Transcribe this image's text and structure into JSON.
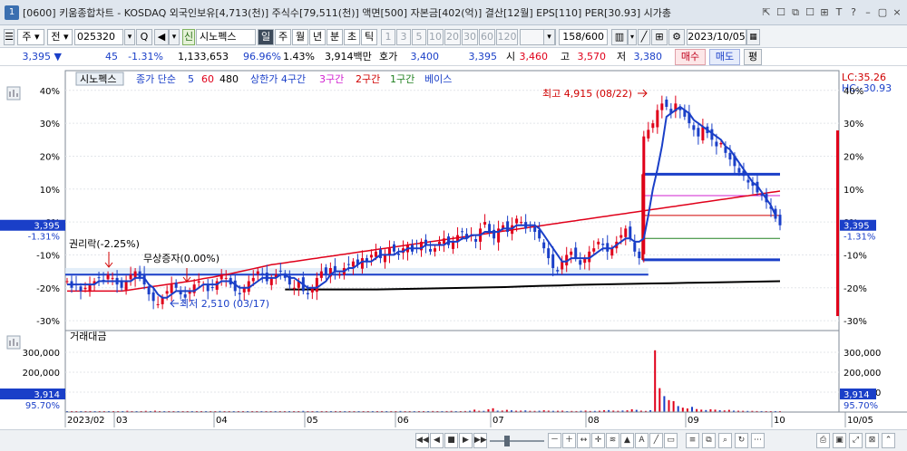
{
  "window": {
    "number": "1",
    "title": "[0600] 키움종합차트 - KOSDAQ 외국인보유[4,713(천)] 주식수[79,511(천)] 액면[500] 자본금[402(억)] 결산[12월] EPS[110] PER[30.93] 시가총",
    "controls": [
      "⇱",
      "☐",
      "⧉",
      "☐",
      "⊞",
      "T",
      "?",
      "–",
      "▢",
      "×"
    ]
  },
  "toolbar": {
    "stock_type": "주",
    "prefix": "전",
    "code": "025320",
    "search_label": "Q",
    "stock_badge": "신",
    "stock_name": "시노펙스",
    "periods": [
      "일",
      "주",
      "월",
      "년",
      "분",
      "초",
      "틱"
    ],
    "active_period": "일",
    "intervals": [
      "1",
      "3",
      "5",
      "10",
      "20",
      "30",
      "60",
      "120"
    ],
    "count": "158/600",
    "date": "2023/10/05"
  },
  "quote": {
    "price": "3,395",
    "change_arrow": "▼",
    "change": "45",
    "change_rate": "-1.31%",
    "volume": "1,133,653",
    "vol_ratio": "96.96%",
    "turnover": "1.43%",
    "trade_amount": "3,914백만",
    "bid_label": "호가",
    "bid": "3,400",
    "ask": "3,395",
    "open_label": "시",
    "open": "3,460",
    "high_label": "고",
    "high": "3,570",
    "low_label": "저",
    "low": "3,380",
    "buy_button": "매수",
    "sell_button": "매도",
    "eval_button": "평"
  },
  "legend": {
    "name": "시노펙스",
    "ma_label": "종가 단순",
    "ma1": "5",
    "ma2": "60",
    "ma3": "480",
    "zone_label": "상한가 4구간",
    "z3": "3구간",
    "z2": "2구간",
    "z1": "1구간",
    "base": "베이스"
  },
  "colors": {
    "up": "#e0001a",
    "down": "#1a3fc8",
    "ma5": "#1a3fc8",
    "ma60": "#e0001a",
    "ma480": "#000000",
    "zone4": "#1a3fc8",
    "zone3": "#d020d0",
    "zone2": "#d00000",
    "zone1": "#208020",
    "baseline": "#1a3fc8"
  },
  "annotations": {
    "high": "최고 4,915 (08/22)",
    "low": "최저 2,510 (03/17)",
    "rights": "권리락(-2.25%)",
    "bonus": "무상증자(0.00%)"
  },
  "right_readout": {
    "lc": "LC:35.26",
    "hc": "HC:-30.93"
  },
  "price_axis": {
    "ticks": [
      "40%",
      "30%",
      "20%",
      "10%",
      "0%",
      "-10%",
      "-20%",
      "-30%"
    ],
    "current_price": "3,395",
    "current_rate": "-1.31%"
  },
  "volume_panel": {
    "title": "거래대금",
    "ticks": [
      "300,000",
      "200,000",
      "100,000"
    ],
    "current": "3,914",
    "ratio": "95.70%"
  },
  "x_axis": {
    "labels": [
      "2023/02",
      "03",
      "04",
      "05",
      "06",
      "07",
      "08",
      "09",
      "10",
      "10/05"
    ]
  },
  "chart_data": {
    "type": "candlestick",
    "x_start": "2023/02",
    "x_end": "2023/10/05",
    "y_unit": "%",
    "ylim": [
      -33,
      46
    ],
    "close_pct": [
      -18,
      -20,
      -19,
      -21,
      -20,
      -19,
      -18,
      -17,
      -18,
      -16,
      -17,
      -19,
      -20,
      -18,
      -16,
      -15,
      -17,
      -19,
      -22,
      -24,
      -25,
      -23,
      -21,
      -19,
      -20,
      -22,
      -23,
      -21,
      -19,
      -18,
      -19,
      -21,
      -20,
      -18,
      -16,
      -17,
      -19,
      -21,
      -22,
      -20,
      -18,
      -17,
      -15,
      -16,
      -18,
      -17,
      -16,
      -15,
      -17,
      -19,
      -20,
      -18,
      -21,
      -22,
      -20,
      -17,
      -15,
      -16,
      -14,
      -15,
      -16,
      -14,
      -13,
      -12,
      -13,
      -11,
      -12,
      -10,
      -9,
      -11,
      -10,
      -8,
      -9,
      -10,
      -8,
      -7,
      -9,
      -8,
      -6,
      -7,
      -9,
      -8,
      -6,
      -5,
      -7,
      -6,
      -4,
      -3,
      -5,
      -4,
      -6,
      -2,
      0,
      -3,
      -5,
      -2,
      -1,
      -3,
      -1,
      1,
      0,
      -2,
      -1,
      -3,
      -5,
      -8,
      -11,
      -14,
      -15,
      -12,
      -10,
      -9,
      -11,
      -13,
      -11,
      -9,
      -8,
      -6,
      -7,
      -9,
      -8,
      -6,
      -4,
      -2,
      -5,
      -9,
      -11,
      26,
      28,
      30,
      34,
      36,
      35,
      33,
      36,
      34,
      32,
      30,
      28,
      26,
      29,
      27,
      25,
      23,
      24,
      21,
      19,
      17,
      15,
      14,
      12,
      11,
      9,
      8,
      6,
      4,
      1,
      -1
    ],
    "ma5_pct": [
      -19,
      -19,
      -19,
      -19,
      -19,
      -19,
      -19,
      -18,
      -18,
      -18,
      -18,
      -18,
      -18,
      -18,
      -18,
      -17,
      -17,
      -17,
      -19,
      -20,
      -22,
      -23,
      -23,
      -22,
      -21,
      -21,
      -21,
      -21,
      -21,
      -20,
      -19,
      -19,
      -19,
      -19,
      -18,
      -18,
      -18,
      -19,
      -20,
      -20,
      -20,
      -19,
      -18,
      -17,
      -17,
      -17,
      -17,
      -16,
      -16,
      -17,
      -17,
      -18,
      -19,
      -20,
      -20,
      -20,
      -19,
      -18,
      -16,
      -15,
      -15,
      -15,
      -14,
      -14,
      -13,
      -12,
      -12,
      -12,
      -11,
      -10,
      -10,
      -10,
      -10,
      -9,
      -9,
      -8,
      -8,
      -8,
      -8,
      -7,
      -7,
      -7,
      -7,
      -7,
      -6,
      -6,
      -6,
      -5,
      -5,
      -4,
      -4,
      -4,
      -3,
      -3,
      -3,
      -3,
      -2,
      -2,
      -2,
      -1,
      -1,
      -1,
      -1,
      -1,
      -2,
      -4,
      -6,
      -8,
      -10,
      -12,
      -12,
      -11,
      -11,
      -11,
      -11,
      -11,
      -10,
      -9,
      -8,
      -8,
      -8,
      -7,
      -6,
      -5,
      -5,
      -6,
      -6,
      -5,
      2,
      10,
      16,
      23,
      32,
      33,
      34,
      35,
      34,
      33,
      31,
      30,
      29,
      28,
      27,
      26,
      25,
      23,
      22,
      20,
      18,
      16,
      14,
      12,
      11,
      9,
      7,
      5,
      2
    ],
    "ma60_pct": [
      -21,
      -21,
      -21,
      -21,
      -21,
      -21,
      -21,
      -21,
      -21,
      -21,
      -21,
      -21,
      -21,
      -20.8,
      -20.6,
      -20.4,
      -20.2,
      -20,
      -19.8,
      -19.6,
      -19.4,
      -19.2,
      -19,
      -18.8,
      -18.6,
      -18.4,
      -18.2,
      -18,
      -17.8,
      -17.5,
      -17.2,
      -17,
      -16.8,
      -16.5,
      -16.2,
      -16,
      -15.7,
      -15.4,
      -15.1,
      -14.8,
      -14.5,
      -14.2,
      -13.9,
      -13.6,
      -13.3,
      -13,
      -12.8,
      -12.6,
      -12.4,
      -12.2,
      -12,
      -11.8,
      -11.6,
      -11.4,
      -11.2,
      -11,
      -10.8,
      -10.6,
      -10.4,
      -10.2,
      -10,
      -9.8,
      -9.6,
      -9.4,
      -9.2,
      -9,
      -8.8,
      -8.6,
      -8.4,
      -8.2,
      -8,
      -7.8,
      -7.6,
      -7.4,
      -7.2,
      -7,
      -6.8,
      -6.6,
      -6.4,
      -6.2,
      -6,
      -5.8,
      -5.6,
      -5.4,
      -5.2,
      -5,
      -4.8,
      -4.6,
      -4.4,
      -4.2,
      -4,
      -3.8,
      -3.6,
      -3.4,
      -3.2,
      -3,
      -2.8,
      -2.6,
      -2.4,
      -2.2,
      -2,
      -1.8,
      -1.6,
      -1.4,
      -1.2,
      -1,
      -0.8,
      -0.6,
      -0.4,
      -0.2,
      0,
      0.2,
      0.4,
      0.6,
      0.8,
      1,
      1.2,
      1.4,
      1.6,
      1.8,
      2,
      2.2,
      2.4,
      2.6,
      2.8,
      3,
      3.2,
      3.4,
      3.6,
      3.8,
      4,
      4.2,
      4.4,
      4.6,
      4.8,
      5,
      5.2,
      5.4,
      5.6,
      5.8,
      6,
      6.2,
      6.4,
      6.6,
      6.8,
      7,
      7.2,
      7.4,
      7.6,
      7.8,
      8,
      8.2,
      8.4,
      8.6,
      8.8,
      9,
      9.2,
      9.4
    ],
    "ma480_pct": [
      -20.5,
      -20.5,
      -20.5,
      -20.5,
      -20.5,
      -20.5,
      -20.4,
      -20.3,
      -20.2,
      -20.1,
      -20,
      -19.9,
      -19.8,
      -19.6,
      -19.4,
      -19.3,
      -19.1,
      -19,
      -18.9,
      -18.8,
      -18.7,
      -18.6,
      -18.5,
      -18.4,
      -18.3,
      -18.2,
      -18.1,
      -18
    ],
    "zones_pct": {
      "zone4_top": 14.5,
      "zone3": 8,
      "zone2": 2,
      "zone1": -5,
      "base": -11.5
    },
    "volume": {
      "unit": "백만",
      "ylim": [
        0,
        400000
      ],
      "values": [
        3914,
        2100,
        2500,
        3000,
        2800,
        2200,
        2600,
        2400,
        3100,
        2700,
        2900,
        3200,
        3500,
        6000,
        3800,
        4100,
        2300,
        5800,
        2600,
        6500,
        3900,
        2800,
        3300,
        2600,
        4700,
        3200,
        2800,
        2500,
        3100,
        2700,
        2400,
        2900,
        3400,
        5200,
        3000,
        2600,
        3600,
        2800,
        2500,
        3100,
        2900,
        3300,
        3700,
        4100,
        3000,
        3600,
        2900,
        3100,
        3800,
        4200,
        3300,
        5600,
        3900,
        4200,
        4600,
        3700,
        3500,
        3300,
        4800,
        4100,
        3600,
        3900,
        3500,
        4000,
        4400,
        3900,
        3700,
        4300,
        4800,
        4100,
        3900,
        4600,
        5200,
        4400,
        3800,
        4100,
        4700,
        3900,
        4500,
        5100,
        4700,
        4200,
        4900,
        5600,
        4400,
        4100,
        5200,
        6300,
        12000,
        6200,
        5800,
        14000,
        19000,
        6900,
        7300,
        11000,
        8400,
        6500,
        7000,
        8100,
        6000,
        5700,
        6400,
        8800,
        7000,
        5900,
        6200,
        6800,
        4600,
        5400,
        4900,
        6100,
        7200,
        5300,
        5700,
        6600,
        8900,
        9800,
        7100,
        6200,
        7600,
        8700,
        14000,
        11000,
        6800,
        5600,
        9400,
        310000,
        120000,
        80000,
        60000,
        55000,
        30000,
        22000,
        18000,
        26000,
        15000,
        12000,
        10000,
        14000,
        12000,
        9000,
        8000,
        11000,
        7000,
        6500,
        6000,
        5500,
        5800,
        5000,
        4800,
        4500,
        4200,
        4000,
        3914
      ]
    }
  }
}
